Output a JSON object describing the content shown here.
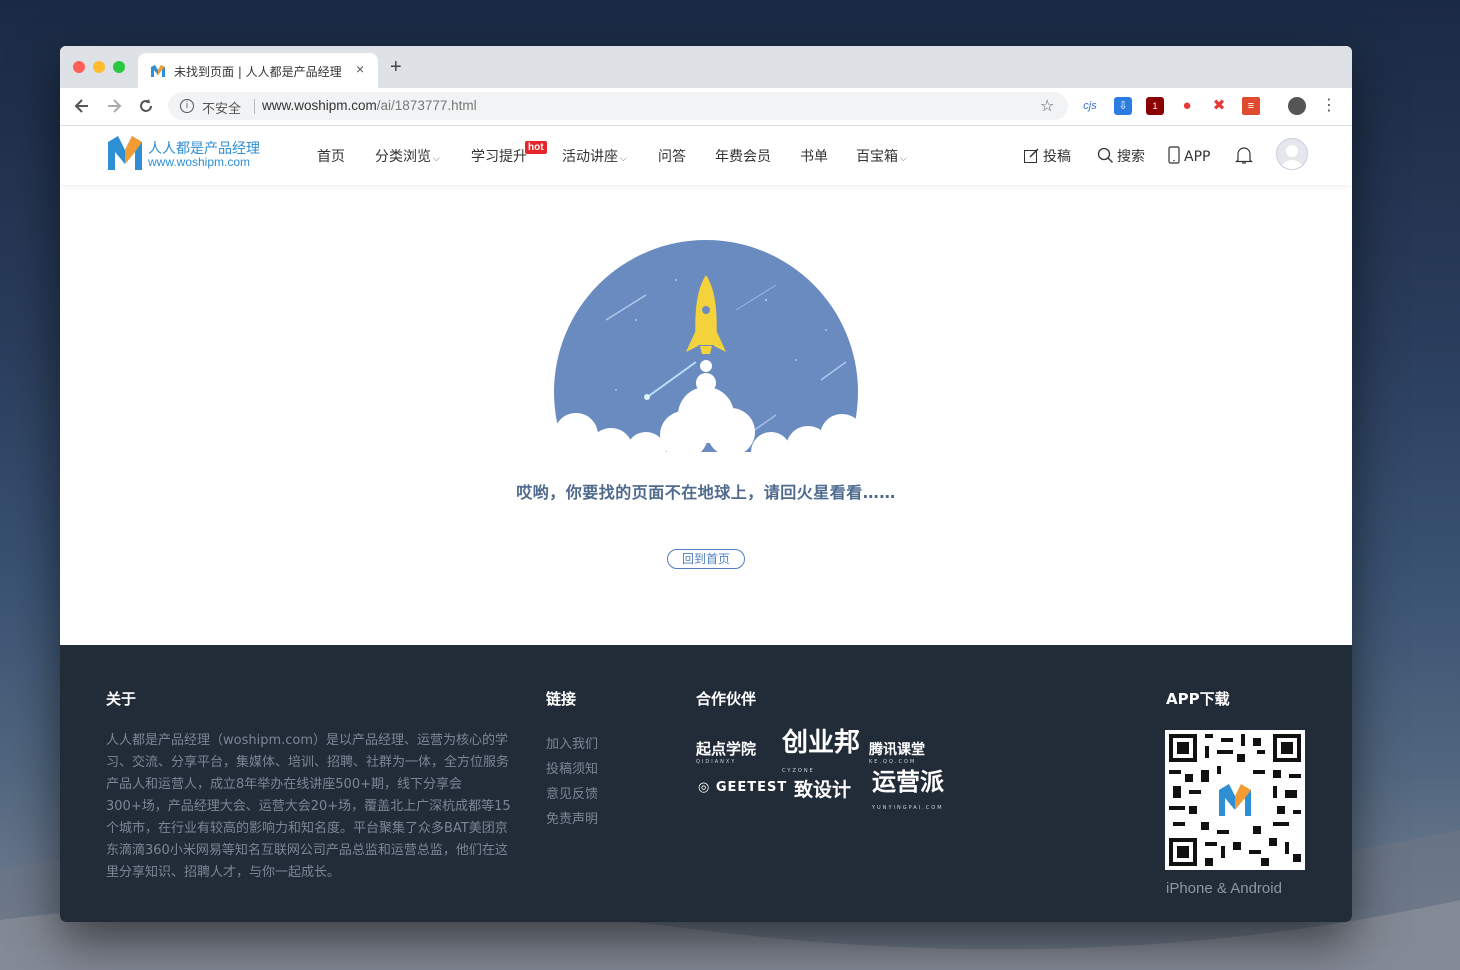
{
  "browser": {
    "tab_title": "未找到页面 | 人人都是产品经理",
    "tab_close": "×",
    "new_tab": "+",
    "security_label": "不安全",
    "url_domain": "www.woshipm.com",
    "url_path": "/ai/1873777.html",
    "extensions": [
      {
        "name": "cjs",
        "label": "cjs",
        "color": "#3b6fd6"
      },
      {
        "name": "download-ext",
        "label": "",
        "color": "#2b7de1"
      },
      {
        "name": "ublock-ext",
        "label": "1",
        "color": "#8b0000"
      },
      {
        "name": "drop-ext",
        "label": "",
        "color": "#e53935"
      },
      {
        "name": "x-ext",
        "label": "✖",
        "color": "#e53935"
      },
      {
        "name": "note-ext",
        "label": "",
        "color": "#e04b2e"
      }
    ]
  },
  "site": {
    "logo_cn": "人人都是产品经理",
    "logo_en": "www.woshipm.com",
    "menu": [
      {
        "label": "首页",
        "dropdown": false
      },
      {
        "label": "分类浏览",
        "dropdown": true
      },
      {
        "label": "学习提升",
        "dropdown": false
      },
      {
        "label": "活动讲座",
        "dropdown": true
      },
      {
        "label": "问答",
        "dropdown": false
      },
      {
        "label": "年费会员",
        "dropdown": false
      },
      {
        "label": "书单",
        "dropdown": false
      },
      {
        "label": "百宝箱",
        "dropdown": true
      }
    ],
    "hot_badge": "hot",
    "tools": {
      "submit": "投稿",
      "search": "搜索",
      "app": "APP"
    }
  },
  "error": {
    "message": "哎哟，你要找的页面不在地球上，请回火星看看……",
    "home_button": "回到首页"
  },
  "footer": {
    "about_title": "关于",
    "about_text": "人人都是产品经理（woshipm.com）是以产品经理、运营为核心的学习、交流、分享平台，集媒体、培训、招聘、社群为一体，全方位服务产品人和运营人，成立8年举办在线讲座500+期，线下分享会300+场，产品经理大会、运营大会20+场，覆盖北上广深杭成都等15个城市，在行业有较高的影响力和知名度。平台聚集了众多BAT美团京东滴滴360小米网易等知名互联网公司产品总监和运营总监，他们在这里分享知识、招聘人才，与你一起成长。",
    "links_title": "链接",
    "links": [
      "加入我们",
      "投稿须知",
      "意见反馈",
      "免责声明"
    ],
    "partners_title": "合作伙伴",
    "partners": [
      {
        "name": "起点学院",
        "sub": "QIDIANXY"
      },
      {
        "name": "创业邦",
        "sub": "CYZONE"
      },
      {
        "name": "腾讯课堂",
        "sub": "KE.QQ.COM"
      },
      {
        "name": "GEETEST",
        "sub": ""
      },
      {
        "name": "致设计",
        "sub": ""
      },
      {
        "name": "运营派",
        "sub": "YUNYINGPAI.COM"
      }
    ],
    "app_title": "APP下载",
    "app_caption": "iPhone & Android"
  }
}
